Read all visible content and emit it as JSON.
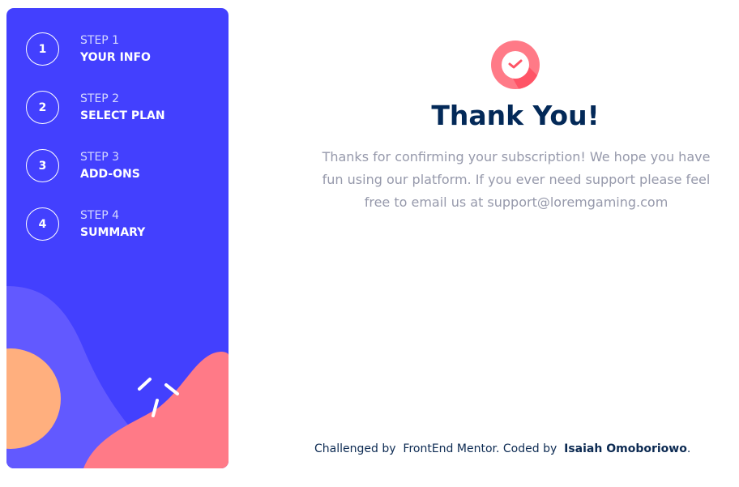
{
  "steps": [
    {
      "number": "1",
      "label": "STEP 1",
      "name": "YOUR INFO"
    },
    {
      "number": "2",
      "label": "STEP 2",
      "name": "SELECT PLAN"
    },
    {
      "number": "3",
      "label": "STEP 3",
      "name": "ADD-ONS"
    },
    {
      "number": "4",
      "label": "STEP 4",
      "name": "SUMMARY"
    }
  ],
  "confirmation": {
    "icon": "check-circle-icon",
    "title": "Thank You!",
    "message": "Thanks for confirming your subscription! We hope you have fun using our platform. If you ever need support please feel free to email us at support@loremgaming.com"
  },
  "footer": {
    "challenged_by": "Challenged by",
    "frontend_mentor": "FrontEnd Mentor",
    "coded_by": ". Coded by",
    "author": "Isaiah Omoboriowo",
    "end": "."
  },
  "colors": {
    "sidebar": "#4340fe",
    "title": "#032958",
    "accent": "#ff7a87"
  }
}
